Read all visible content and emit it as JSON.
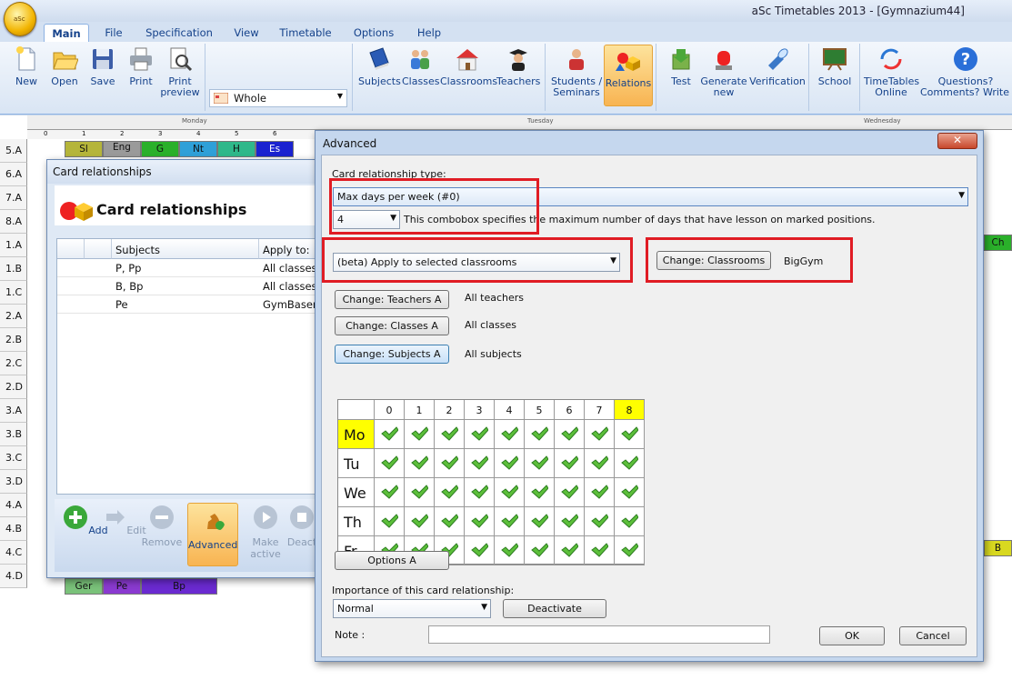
{
  "app": {
    "title": "aSc Timetables 2013  - [Gymnazium44]",
    "icon_text": "aSc"
  },
  "tabs": [
    "Main",
    "File",
    "Specification",
    "View",
    "Timetable",
    "Options",
    "Help"
  ],
  "ribbon": {
    "buttons": [
      {
        "label": "New",
        "icon": "new-file-icon"
      },
      {
        "label": "Open",
        "icon": "folder-icon"
      },
      {
        "label": "Save",
        "icon": "floppy-icon"
      },
      {
        "label": "Print",
        "icon": "printer-icon"
      },
      {
        "label": "Print\npreview",
        "icon": "print-preview-icon"
      },
      {
        "label": "Subjects",
        "icon": "book-icon"
      },
      {
        "label": "Classes",
        "icon": "people-icon"
      },
      {
        "label": "Classrooms",
        "icon": "house-icon"
      },
      {
        "label": "Teachers",
        "icon": "teacher-icon"
      },
      {
        "label": "Students /\nSeminars",
        "icon": "students-icon"
      },
      {
        "label": "Relations",
        "icon": "relations-icon"
      },
      {
        "label": "Test",
        "icon": "test-icon"
      },
      {
        "label": "Generate\nnew",
        "icon": "generate-icon"
      },
      {
        "label": "Verification",
        "icon": "flashlight-icon"
      },
      {
        "label": "School",
        "icon": "chalkboard-icon"
      },
      {
        "label": "TimeTables\nOnline",
        "icon": "sync-icon"
      },
      {
        "label": "Questions?\nComments? Write us",
        "icon": "help-icon"
      }
    ],
    "view_select": "Whole"
  },
  "timetable": {
    "days": [
      "Monday",
      "Tuesday",
      "Wednesday"
    ],
    "periods": [
      "0",
      "1",
      "2",
      "3",
      "4",
      "5",
      "6"
    ],
    "classes": [
      "5.A",
      "6.A",
      "7.A",
      "8.A",
      "1.A",
      "1.B",
      "1.C",
      "2.A",
      "2.B",
      "2.C",
      "2.D",
      "3.A",
      "3.B",
      "3.C",
      "3.D",
      "4.A",
      "4.B",
      "4.C",
      "4.D"
    ],
    "row0_cells": [
      "Sl",
      "Eng",
      "G",
      "Nt",
      "H",
      "Es"
    ],
    "row0_sub": "Sl",
    "bottom_cells": [
      "Ger",
      "Pe",
      "Bp"
    ],
    "right_cells": [
      "Ch",
      "B"
    ]
  },
  "card_relationships": {
    "window_title": "Card relationships",
    "heading": "Card relationships",
    "columns": [
      "Subjects",
      "Apply to:"
    ],
    "rows": [
      {
        "subjects": "P, Pp",
        "apply": "All classes"
      },
      {
        "subjects": "B, Bp",
        "apply": "All classes"
      },
      {
        "subjects": "Pe",
        "apply": "GymBasem"
      }
    ],
    "toolbar": [
      "Add",
      "Edit",
      "Remove",
      "Advanced",
      "Make\nactive",
      "Deact"
    ]
  },
  "advanced": {
    "title": "Advanced",
    "close": "✕",
    "type_label": "Card relationship type:",
    "type_value": "Max days per week (#0)",
    "days_value": "4",
    "days_desc": "This combobox specifies the maximum number of days that have lesson on marked positions.",
    "apply_value": "(beta) Apply to selected classrooms",
    "change_classrooms": "Change: Classrooms",
    "classrooms_value": "BigGym",
    "change_teachers": "Change: Teachers A",
    "teachers_value": "All teachers",
    "change_classes": "Change: Classes A",
    "classes_value": "All classes",
    "change_subjects": "Change: Subjects A",
    "subjects_value": "All subjects",
    "grid_periods": [
      "0",
      "1",
      "2",
      "3",
      "4",
      "5",
      "6",
      "7",
      "8"
    ],
    "grid_days": [
      "Mo",
      "Tu",
      "We",
      "Th",
      "Fr"
    ],
    "options_btn": "Options A",
    "importance_label": "Importance of this card relationship:",
    "importance_value": "Normal",
    "deactivate": "Deactivate",
    "note_label": "Note :",
    "note_value": "",
    "ok": "OK",
    "cancel": "Cancel"
  }
}
